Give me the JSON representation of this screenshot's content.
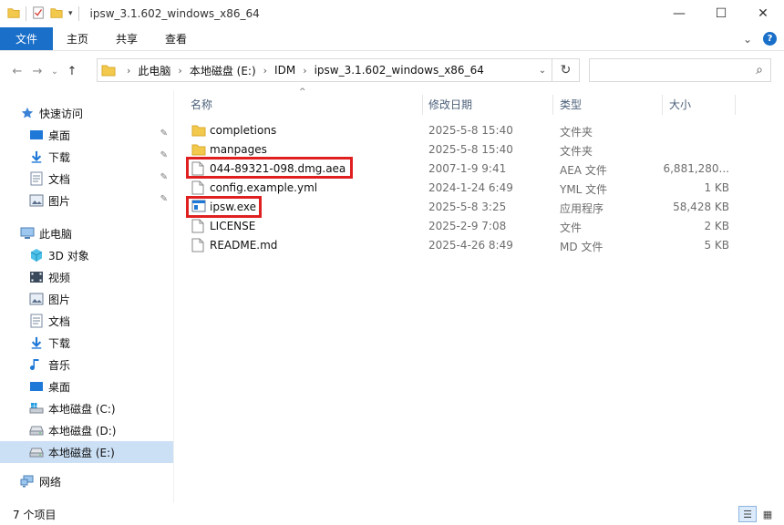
{
  "window": {
    "title": "ipsw_3.1.602_windows_x86_64",
    "controls": {
      "minimize": "—",
      "maximize": "☐",
      "close": "✕"
    }
  },
  "ribbon": {
    "tabs": [
      "文件",
      "主页",
      "共享",
      "查看"
    ],
    "expand_glyph": "⌄",
    "help_glyph": "?"
  },
  "nav": {
    "back": "←",
    "forward": "→",
    "recent": "⌄",
    "up": "↑",
    "breadcrumb": [
      "此电脑",
      "本地磁盘 (E:)",
      "IDM",
      "ipsw_3.1.602_windows_x86_64"
    ],
    "separator": "›",
    "dropdown": "⌄",
    "refresh": "↻",
    "search_glyph": "⌕"
  },
  "sidebar": {
    "quick_access": {
      "label": "快速访问",
      "items": [
        {
          "label": "桌面",
          "icon": "desktop-icon",
          "pinned": true
        },
        {
          "label": "下载",
          "icon": "download-icon",
          "pinned": true
        },
        {
          "label": "文档",
          "icon": "document-icon",
          "pinned": true
        },
        {
          "label": "图片",
          "icon": "pictures-icon",
          "pinned": true
        }
      ]
    },
    "this_pc": {
      "label": "此电脑",
      "items": [
        {
          "label": "3D 对象",
          "icon": "3d-objects-icon"
        },
        {
          "label": "视频",
          "icon": "video-icon"
        },
        {
          "label": "图片",
          "icon": "pictures-icon"
        },
        {
          "label": "文档",
          "icon": "document-icon"
        },
        {
          "label": "下载",
          "icon": "download-icon"
        },
        {
          "label": "音乐",
          "icon": "music-icon"
        },
        {
          "label": "桌面",
          "icon": "desktop-icon"
        },
        {
          "label": "本地磁盘 (C:)",
          "icon": "system-drive-icon"
        },
        {
          "label": "本地磁盘 (D:)",
          "icon": "drive-icon"
        },
        {
          "label": "本地磁盘 (E:)",
          "icon": "drive-icon",
          "selected": true
        }
      ]
    },
    "network": {
      "label": "网络",
      "icon": "network-icon"
    },
    "pin_glyph": "📌"
  },
  "columns": {
    "name": "名称",
    "date": "修改日期",
    "type": "类型",
    "size": "大小",
    "sort_glyph": "^"
  },
  "files": [
    {
      "name": "completions",
      "date": "2025-5-8 15:40",
      "type": "文件夹",
      "size": "",
      "icon": "folder-icon"
    },
    {
      "name": "manpages",
      "date": "2025-5-8 15:40",
      "type": "文件夹",
      "size": "",
      "icon": "folder-icon"
    },
    {
      "name": "044-89321-098.dmg.aea",
      "date": "2007-1-9 9:41",
      "type": "AEA 文件",
      "size": "6,881,280...",
      "icon": "file-icon",
      "highlighted": true
    },
    {
      "name": "config.example.yml",
      "date": "2024-1-24 6:49",
      "type": "YML 文件",
      "size": "1 KB",
      "icon": "file-icon"
    },
    {
      "name": "ipsw.exe",
      "date": "2025-5-8 3:25",
      "type": "应用程序",
      "size": "58,428 KB",
      "icon": "exe-icon",
      "highlighted": true
    },
    {
      "name": "LICENSE",
      "date": "2025-2-9 7:08",
      "type": "文件",
      "size": "2 KB",
      "icon": "file-icon"
    },
    {
      "name": "README.md",
      "date": "2025-4-26 8:49",
      "type": "MD 文件",
      "size": "5 KB",
      "icon": "file-icon"
    }
  ],
  "status": {
    "item_count": "7 个项目"
  },
  "colors": {
    "accent": "#1a6fc9",
    "selected": "#cce0f5",
    "highlight_box": "#e02020",
    "folder": "#f2c94c"
  }
}
